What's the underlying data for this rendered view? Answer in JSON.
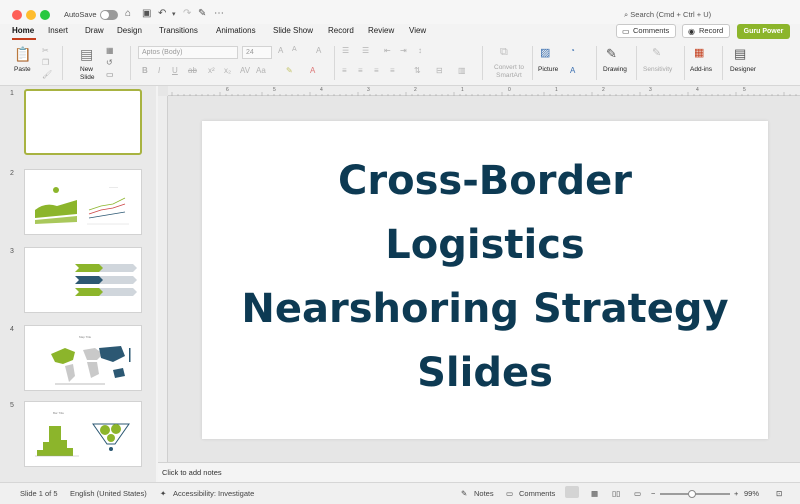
{
  "window": {
    "autosave_label": "AutoSave",
    "search_placeholder": "Search (Cmd + Ctrl + U)"
  },
  "tabs": [
    "Home",
    "Insert",
    "Draw",
    "Design",
    "Transitions",
    "Animations",
    "Slide Show",
    "Record",
    "Review",
    "View"
  ],
  "header_buttons": {
    "comments": "Comments",
    "record": "Record",
    "guru": "Guru Power"
  },
  "ribbon": {
    "paste": "Paste",
    "new_slide_line1": "New",
    "new_slide_line2": "Slide",
    "font_name": "Aptos (Body)",
    "font_size": "24",
    "convert_line1": "Convert to",
    "convert_line2": "SmartArt",
    "picture": "Picture",
    "drawing": "Drawing",
    "sensitivity": "Sensitivity",
    "addins": "Add-ins",
    "designer": "Designer"
  },
  "thumbnails": {
    "numbers": [
      "1",
      "2",
      "3",
      "4",
      "5"
    ],
    "map_title": "Map Title",
    "bar_title": "Bar Title"
  },
  "slide": {
    "title_lines": [
      "Cross-Border",
      "Logistics",
      "Nearshoring Strategy",
      "Slides"
    ],
    "title_color": "#0d3a53"
  },
  "notes_placeholder": "Click to add notes",
  "ruler_numbers": [
    "6",
    "5",
    "4",
    "3",
    "2",
    "1",
    "0",
    "1",
    "2",
    "3",
    "4",
    "5",
    "6"
  ],
  "status": {
    "slide_count": "Slide 1 of 5",
    "language": "English (United States)",
    "accessibility": "Accessibility: Investigate",
    "notes": "Notes",
    "comments": "Comments",
    "zoom": "99%"
  },
  "colors": {
    "accent": "#c43e1c",
    "guru": "#8cb52b",
    "thumb_green": "#8cb52b",
    "thumb_navy": "#2c5873"
  }
}
